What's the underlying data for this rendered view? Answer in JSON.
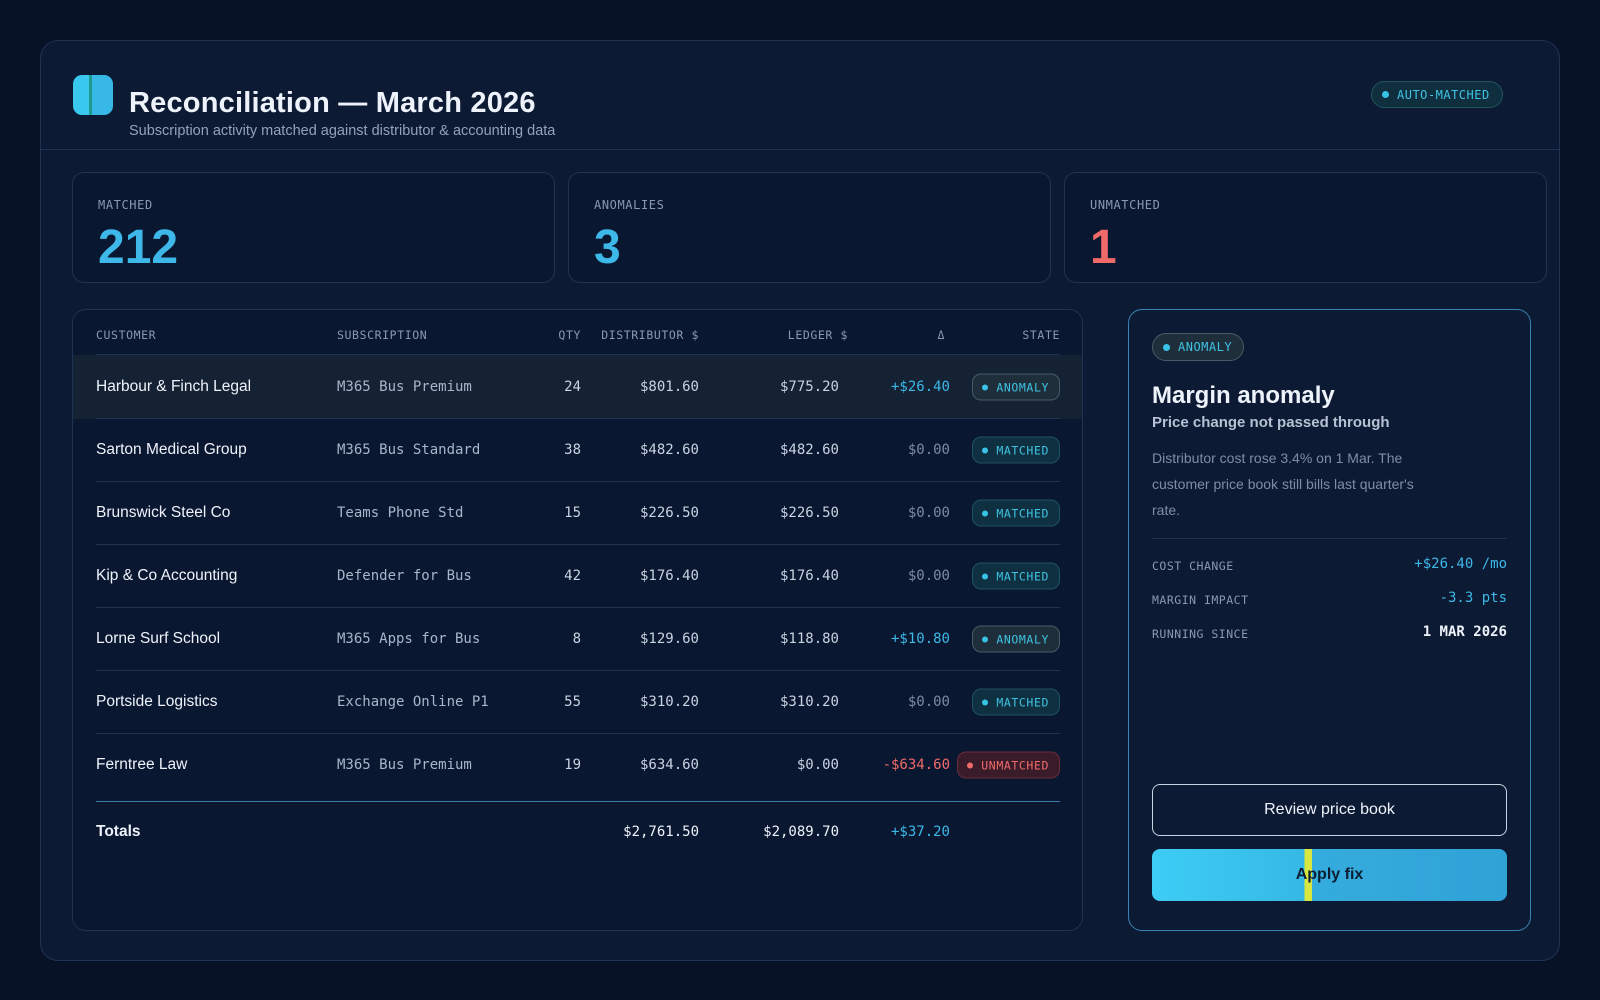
{
  "header": {
    "title": "Reconciliation — March 2026",
    "subtitle": "Subscription activity matched against distributor & accounting data",
    "status": "AUTO-MATCHED"
  },
  "stats": [
    {
      "label": "MATCHED",
      "value": "212"
    },
    {
      "label": "ANOMALIES",
      "value": "3"
    },
    {
      "label": "UNMATCHED",
      "value": "1"
    }
  ],
  "table": {
    "columns": {
      "customer": "CUSTOMER",
      "subscription": "SUBSCRIPTION",
      "qty": "QTY",
      "distributor": "DISTRIBUTOR $",
      "ledger": "LEDGER $",
      "delta": "Δ",
      "state": "STATE"
    },
    "rows": [
      {
        "customer": "Harbour & Finch Legal",
        "subscription": "M365 Bus Premium",
        "qty": "24",
        "distributor": "$801.60",
        "ledger": "$775.20",
        "delta": "+$26.40",
        "state": "ANOMALY"
      },
      {
        "customer": "Sarton Medical Group",
        "subscription": "M365 Bus Standard",
        "qty": "38",
        "distributor": "$482.60",
        "ledger": "$482.60",
        "delta": "$0.00",
        "state": "MATCHED"
      },
      {
        "customer": "Brunswick Steel Co",
        "subscription": "Teams Phone Std",
        "qty": "15",
        "distributor": "$226.50",
        "ledger": "$226.50",
        "delta": "$0.00",
        "state": "MATCHED"
      },
      {
        "customer": "Kip & Co Accounting",
        "subscription": "Defender for Bus",
        "qty": "42",
        "distributor": "$176.40",
        "ledger": "$176.40",
        "delta": "$0.00",
        "state": "MATCHED"
      },
      {
        "customer": "Lorne Surf School",
        "subscription": "M365 Apps for Bus",
        "qty": "8",
        "distributor": "$129.60",
        "ledger": "$118.80",
        "delta": "+$10.80",
        "state": "ANOMALY"
      },
      {
        "customer": "Portside Logistics",
        "subscription": "Exchange Online P1",
        "qty": "55",
        "distributor": "$310.20",
        "ledger": "$310.20",
        "delta": "$0.00",
        "state": "MATCHED"
      },
      {
        "customer": "Ferntree Law",
        "subscription": "M365 Bus Premium",
        "qty": "19",
        "distributor": "$634.60",
        "ledger": "$0.00",
        "delta": "-$634.60",
        "state": "UNMATCHED"
      }
    ],
    "totals": {
      "label": "Totals",
      "distributor": "$2,761.50",
      "ledger": "$2,089.70",
      "delta": "+$37.20"
    }
  },
  "detail": {
    "badge": "ANOMALY",
    "title": "Margin anomaly",
    "subtitle": "Price change not passed through",
    "description": "Distributor cost rose 3.4% on 1 Mar. The customer price book still bills last quarter's rate.",
    "metrics": [
      {
        "label": "COST CHANGE",
        "value": "+$26.40 /mo"
      },
      {
        "label": "MARGIN IMPACT",
        "value": "-3.3 pts"
      },
      {
        "label": "RUNNING SINCE",
        "value": "1 MAR 2026"
      }
    ],
    "secondary_button": "Review price book",
    "primary_button": "Apply fix"
  }
}
